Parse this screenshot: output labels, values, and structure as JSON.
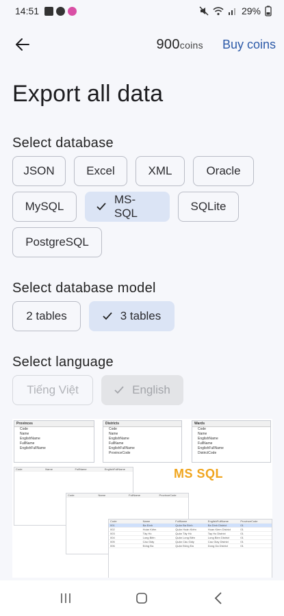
{
  "status_bar": {
    "time": "14:51",
    "battery": "29%"
  },
  "header": {
    "coins_value": "900",
    "coins_unit": "coins",
    "buy_coins": "Buy coins"
  },
  "title": "Export all data",
  "database": {
    "label": "Select database",
    "options": [
      "JSON",
      "Excel",
      "XML",
      "Oracle",
      "MySQL",
      "MS-SQL",
      "SQLite",
      "PostgreSQL"
    ],
    "selected": "MS-SQL"
  },
  "model": {
    "label": "Select database model",
    "options": [
      "2 tables",
      "3 tables"
    ],
    "selected": "3 tables"
  },
  "language": {
    "label": "Select language",
    "options": [
      "Tiếng Việt",
      "English"
    ],
    "selected": "English"
  },
  "preview": {
    "badge": "MS SQL",
    "tables": [
      {
        "name": "Provinces",
        "fields": [
          "Code",
          "Name",
          "EnglishName",
          "FullName",
          "EnglishFullName"
        ]
      },
      {
        "name": "Districts",
        "fields": [
          "Code",
          "Name",
          "EnglishName",
          "FullName",
          "EnglishFullName",
          "ProvinceCode"
        ]
      },
      {
        "name": "Wards",
        "fields": [
          "Code",
          "Name",
          "EnglishName",
          "FullName",
          "EnglishFullName",
          "DistrictCode"
        ]
      }
    ],
    "grid_headers": [
      "Code",
      "Name",
      "FullName",
      "EnglishFullName",
      "ProvinceCode"
    ],
    "grid_rows": [
      [
        "001",
        "Ba Đình",
        "Quận Ba Đình",
        "Ba Dinh District",
        "01"
      ],
      [
        "002",
        "Hoàn Kiếm",
        "Quận Hoàn Kiếm",
        "Hoan Kiem District",
        "01"
      ],
      [
        "003",
        "Tây Hồ",
        "Quận Tây Hồ",
        "Tay Ho District",
        "01"
      ],
      [
        "004",
        "Long Biên",
        "Quận Long Biên",
        "Long Bien District",
        "01"
      ],
      [
        "005",
        "Cầu Giấy",
        "Quận Cầu Giấy",
        "Cau Giay District",
        "01"
      ],
      [
        "006",
        "Đống Đa",
        "Quận Đống Đa",
        "Dong Da District",
        "01"
      ]
    ]
  },
  "colors": {
    "accent": "#2c5aa8",
    "selected_chip": "#dbe4f5",
    "badge": "#f0a51d"
  }
}
